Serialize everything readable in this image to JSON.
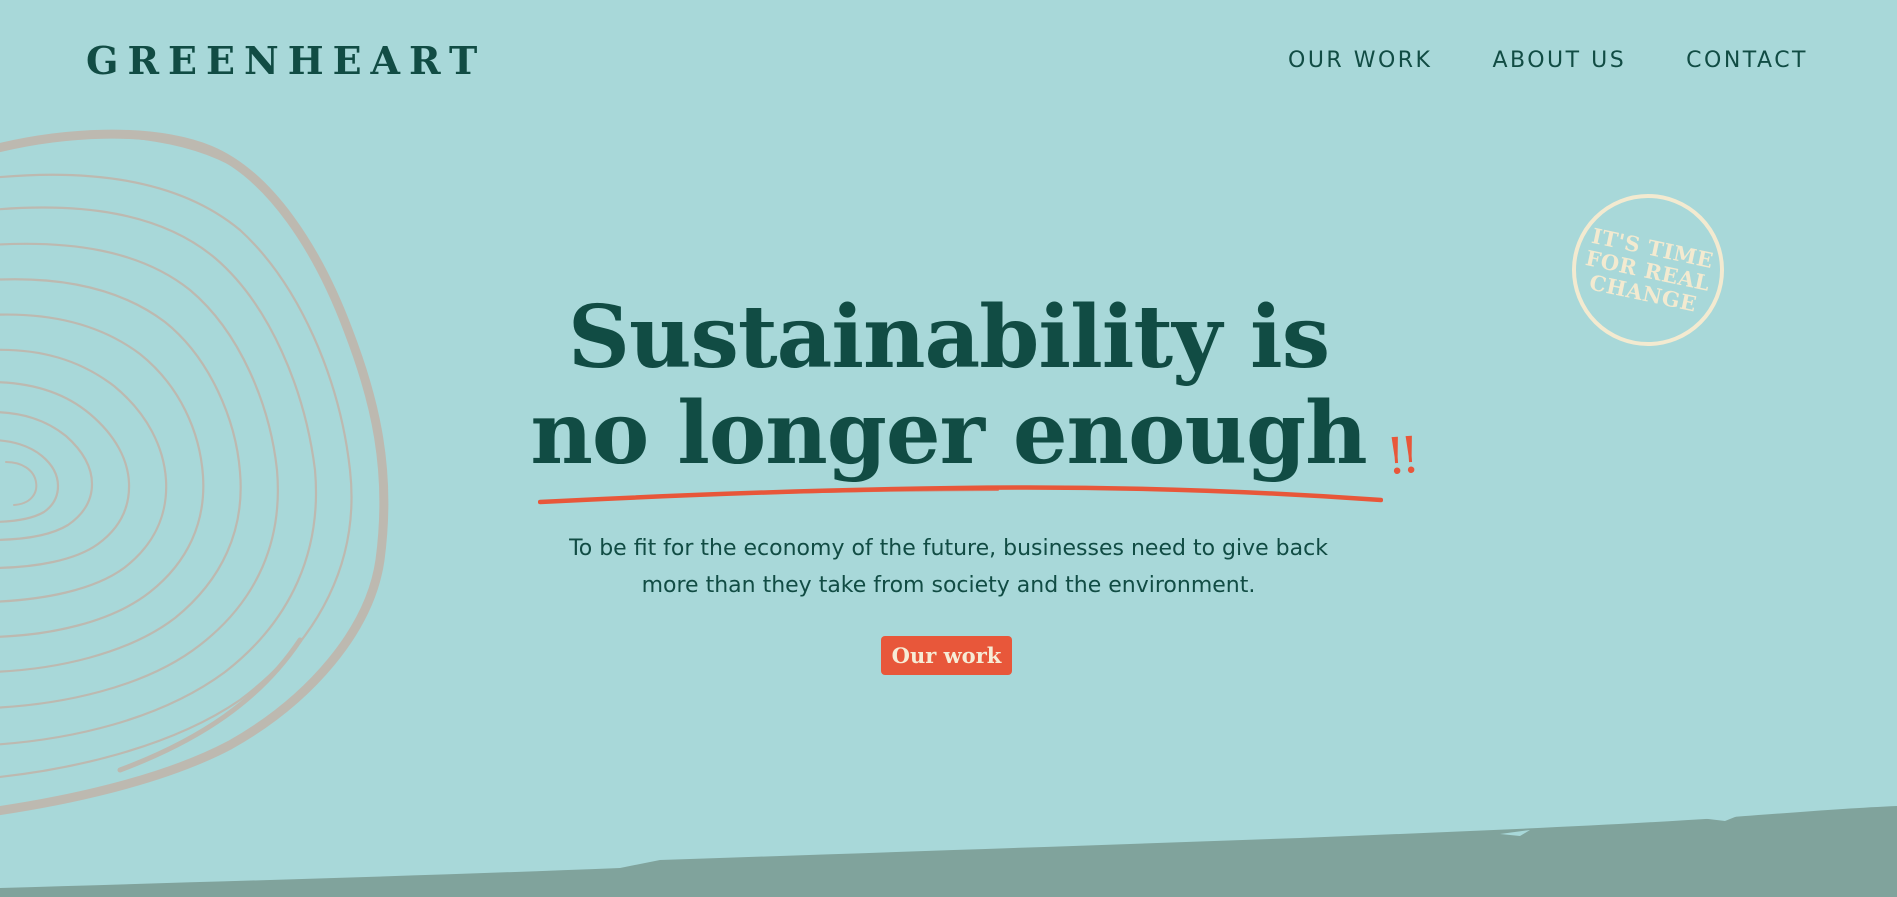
{
  "brand": {
    "logo": "GREENHEART"
  },
  "nav": {
    "items": [
      {
        "label": "OUR WORK"
      },
      {
        "label": "ABOUT US"
      },
      {
        "label": "CONTACT"
      }
    ]
  },
  "hero": {
    "headline_line1": "Sustainability is",
    "headline_line2": "no longer enough",
    "headline_accent": "!!",
    "subtext_line1": "To be fit for the economy of the future, businesses need to give back",
    "subtext_line2": "more than they take from society and the environment.",
    "cta_label": "Our work"
  },
  "stamp": {
    "line1": "IT'S TIME",
    "line2": "FOR REAL",
    "line3": "CHANGE"
  },
  "colors": {
    "background": "#a8d8d9",
    "primary_text": "#114c44",
    "accent": "#e8573a",
    "cream": "#f3ead0",
    "tree_rings": "#bdb9b0",
    "ground": "#80a39c"
  },
  "icons": {
    "tree_rings": "tree-rings-illustration",
    "underline": "brush-underline"
  }
}
